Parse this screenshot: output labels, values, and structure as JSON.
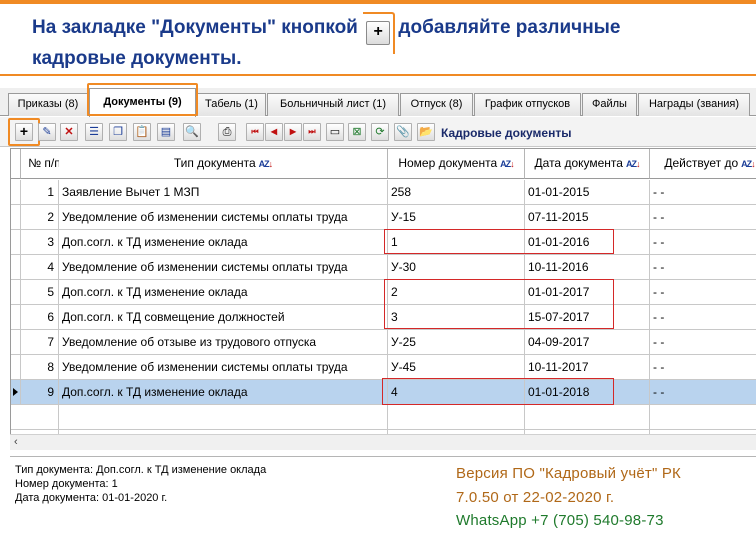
{
  "banner": {
    "text_before": "На закладке \"Документы\" кнопкой",
    "plus_glyph": "+",
    "text_after": "добавляйте различные",
    "line2": "кадровые документы."
  },
  "tabs": [
    {
      "label": "Приказы (8)"
    },
    {
      "label": "Документы (9)",
      "active": true
    },
    {
      "label": "Табель (1)"
    },
    {
      "label": "Больничный лист (1)"
    },
    {
      "label": "Отпуск (8)"
    },
    {
      "label": "График отпусков"
    },
    {
      "label": "Файлы"
    },
    {
      "label": "Награды (звания)"
    }
  ],
  "toolbar": {
    "title": "Кадровые документы",
    "add_glyph": "+",
    "edit_glyph": "✎",
    "delete_glyph": "✕",
    "buttons": [
      {
        "icon": "list-icon",
        "glyph": "☰"
      },
      {
        "icon": "copy-icon",
        "glyph": "❐"
      },
      {
        "icon": "paste-icon",
        "glyph": "📋"
      },
      {
        "icon": "properties-icon",
        "glyph": "▤"
      },
      {
        "icon": "preview-icon",
        "glyph": "🔍"
      },
      {
        "icon": "print-icon",
        "glyph": "⎙"
      },
      {
        "icon": "first-record-icon",
        "glyph": "⏮"
      },
      {
        "icon": "prev-record-icon",
        "glyph": "◀"
      },
      {
        "icon": "next-record-icon",
        "glyph": "▶"
      },
      {
        "icon": "last-record-icon",
        "glyph": "⏭"
      },
      {
        "icon": "archive-icon",
        "glyph": "▭"
      },
      {
        "icon": "excel-export-icon",
        "glyph": "⊠"
      },
      {
        "icon": "refresh-icon",
        "glyph": "⟳"
      },
      {
        "icon": "attach-icon",
        "glyph": "📎"
      },
      {
        "icon": "folder-open-icon",
        "glyph": "📂"
      }
    ],
    "accent": "#f08a24"
  },
  "grid": {
    "headers": {
      "num": "№ п/п",
      "type": "Тип документа",
      "number": "Номер документа",
      "date": "Дата документа",
      "valid_until": "Действует до"
    },
    "rows": [
      {
        "n": "1",
        "type": "Заявление Вычет 1 МЗП",
        "number": "258",
        "date": "01-01-2015",
        "valid": "-  -"
      },
      {
        "n": "2",
        "type": "Уведомление об изменении системы оплаты труда",
        "number": "У-15",
        "date": "07-11-2015",
        "valid": "-  -"
      },
      {
        "n": "3",
        "type": "Доп.согл. к ТД изменение оклада",
        "number": "1",
        "date": "01-01-2016",
        "valid": "-  -"
      },
      {
        "n": "4",
        "type": "Уведомление об изменении системы оплаты труда",
        "number": "У-30",
        "date": "10-11-2016",
        "valid": "-  -"
      },
      {
        "n": "5",
        "type": "Доп.согл. к ТД изменение оклада",
        "number": "2",
        "date": "01-01-2017",
        "valid": "-  -"
      },
      {
        "n": "6",
        "type": "Доп.согл. к ТД совмещение должностей",
        "number": "3",
        "date": "15-07-2017",
        "valid": "-  -"
      },
      {
        "n": "7",
        "type": "Уведомление об отзыве из трудового отпуска",
        "number": "У-25",
        "date": "04-09-2017",
        "valid": "-  -"
      },
      {
        "n": "8",
        "type": "Уведомление об изменении системы оплаты труда",
        "number": "У-45",
        "date": "10-11-2017",
        "valid": "-  -"
      },
      {
        "n": "9",
        "type": "Доп.согл. к ТД изменение оклада",
        "number": "4",
        "date": "01-01-2018",
        "valid": "-  -",
        "selected": true
      }
    ],
    "selected_color": "#b9d3ee",
    "highlight_color": "#d42828"
  },
  "status": {
    "type_line": "Тип документа: Доп.согл. к ТД изменение оклада",
    "number_line": "Номер документа: 1",
    "date_line": "Дата документа: 01-01-2020 г."
  },
  "version": {
    "line1": "Версия ПО \"Кадровый учёт\" РК",
    "line2": "7.0.50 от 22-02-2020 г.",
    "line3": "WhatsApp +7 (705) 540-98-73"
  }
}
